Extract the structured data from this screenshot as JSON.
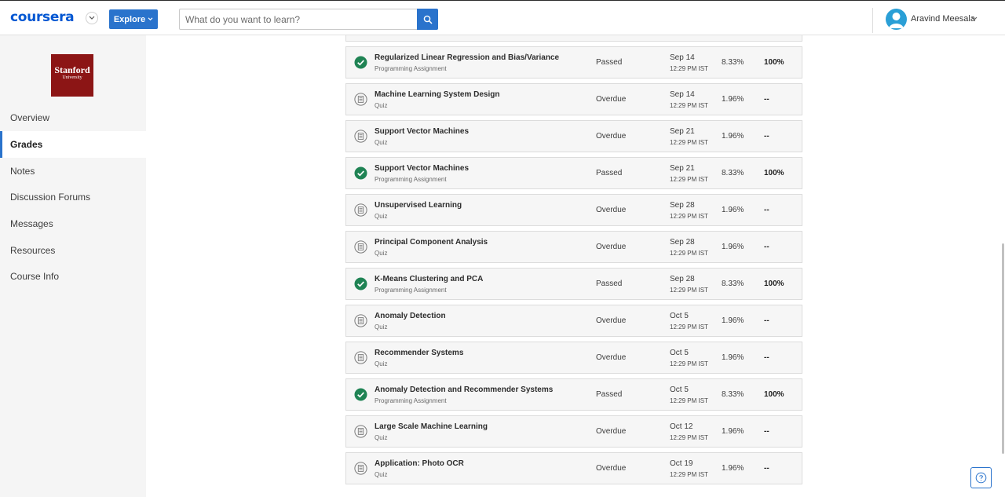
{
  "header": {
    "logo": "coursera",
    "explore_label": "Explore",
    "search_placeholder": "What do you want to learn?",
    "user_name": "Aravind Meesala"
  },
  "sidebar": {
    "university_name": "Stanford",
    "university_sub": "University",
    "items": [
      {
        "label": "Overview",
        "active": false
      },
      {
        "label": "Grades",
        "active": true
      },
      {
        "label": "Notes",
        "active": false
      },
      {
        "label": "Discussion Forums",
        "active": false
      },
      {
        "label": "Messages",
        "active": false
      },
      {
        "label": "Resources",
        "active": false
      },
      {
        "label": "Course Info",
        "active": false
      }
    ]
  },
  "assignments": [
    {
      "title": "Regularized Linear Regression and Bias/Variance",
      "type": "Programming Assignment",
      "status": "Passed",
      "date": "Sep 14",
      "time": "12:29 PM IST",
      "weight": "8.33%",
      "grade": "100%",
      "icon": "check-circle-icon"
    },
    {
      "title": "Machine Learning System Design",
      "type": "Quiz",
      "status": "Overdue",
      "date": "Sep 14",
      "time": "12:29 PM IST",
      "weight": "1.96%",
      "grade": "--",
      "icon": "quiz-icon"
    },
    {
      "title": "Support Vector Machines",
      "type": "Quiz",
      "status": "Overdue",
      "date": "Sep 21",
      "time": "12:29 PM IST",
      "weight": "1.96%",
      "grade": "--",
      "icon": "quiz-icon"
    },
    {
      "title": "Support Vector Machines",
      "type": "Programming Assignment",
      "status": "Passed",
      "date": "Sep 21",
      "time": "12:29 PM IST",
      "weight": "8.33%",
      "grade": "100%",
      "icon": "check-circle-icon"
    },
    {
      "title": "Unsupervised Learning",
      "type": "Quiz",
      "status": "Overdue",
      "date": "Sep 28",
      "time": "12:29 PM IST",
      "weight": "1.96%",
      "grade": "--",
      "icon": "quiz-icon"
    },
    {
      "title": "Principal Component Analysis",
      "type": "Quiz",
      "status": "Overdue",
      "date": "Sep 28",
      "time": "12:29 PM IST",
      "weight": "1.96%",
      "grade": "--",
      "icon": "quiz-icon"
    },
    {
      "title": "K-Means Clustering and PCA",
      "type": "Programming Assignment",
      "status": "Passed",
      "date": "Sep 28",
      "time": "12:29 PM IST",
      "weight": "8.33%",
      "grade": "100%",
      "icon": "check-circle-icon"
    },
    {
      "title": "Anomaly Detection",
      "type": "Quiz",
      "status": "Overdue",
      "date": "Oct 5",
      "time": "12:29 PM IST",
      "weight": "1.96%",
      "grade": "--",
      "icon": "quiz-icon"
    },
    {
      "title": "Recommender Systems",
      "type": "Quiz",
      "status": "Overdue",
      "date": "Oct 5",
      "time": "12:29 PM IST",
      "weight": "1.96%",
      "grade": "--",
      "icon": "quiz-icon"
    },
    {
      "title": "Anomaly Detection and Recommender Systems",
      "type": "Programming Assignment",
      "status": "Passed",
      "date": "Oct 5",
      "time": "12:29 PM IST",
      "weight": "8.33%",
      "grade": "100%",
      "icon": "check-circle-icon"
    },
    {
      "title": "Large Scale Machine Learning",
      "type": "Quiz",
      "status": "Overdue",
      "date": "Oct 12",
      "time": "12:29 PM IST",
      "weight": "1.96%",
      "grade": "--",
      "icon": "quiz-icon"
    },
    {
      "title": "Application: Photo OCR",
      "type": "Quiz",
      "status": "Overdue",
      "date": "Oct 19",
      "time": "12:29 PM IST",
      "weight": "1.96%",
      "grade": "--",
      "icon": "quiz-icon"
    }
  ],
  "colors": {
    "brand_blue": "#0056d2",
    "button_blue": "#2a73cc",
    "passed_green": "#1f8354",
    "stanford_red": "#8c1515"
  }
}
